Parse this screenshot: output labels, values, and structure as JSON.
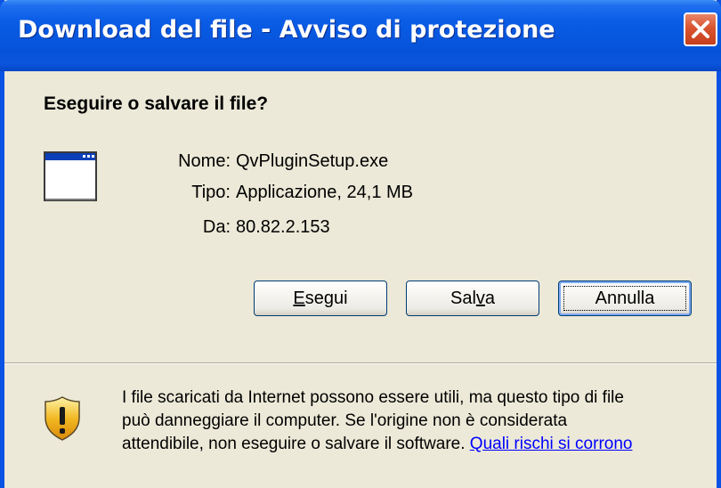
{
  "window": {
    "title": "Download del file - Avviso di protezione"
  },
  "dialog": {
    "heading": "Eseguire o salvare il file?",
    "file": {
      "name_label": "Nome:",
      "name_value": "QvPluginSetup.exe",
      "type_label": "Tipo:",
      "type_value": "Applicazione, 24,1 MB",
      "from_label": "Da:",
      "from_value": "80.82.2.153"
    },
    "buttons": {
      "run_first": "E",
      "run_rest": "segui",
      "save_first": "Sal",
      "save_underlined": "v",
      "save_rest": "a",
      "cancel": "Annulla"
    },
    "warning": {
      "line1": "I file scaricati da Internet possono essere utili, ma questo tipo di file",
      "line2": "può danneggiare il computer. Se l'origine non è considerata",
      "line3": "attendibile, non eseguire o salvare il software.",
      "link": "Quali rischi si corrono"
    }
  },
  "icons": {
    "close": "close-icon",
    "app": "application-window-icon",
    "shield": "security-shield-icon"
  },
  "colors": {
    "titlebar": "#0a5ce6",
    "window_bg": "#ece9d8",
    "close_button": "#d9532f",
    "link": "#0000ff"
  }
}
